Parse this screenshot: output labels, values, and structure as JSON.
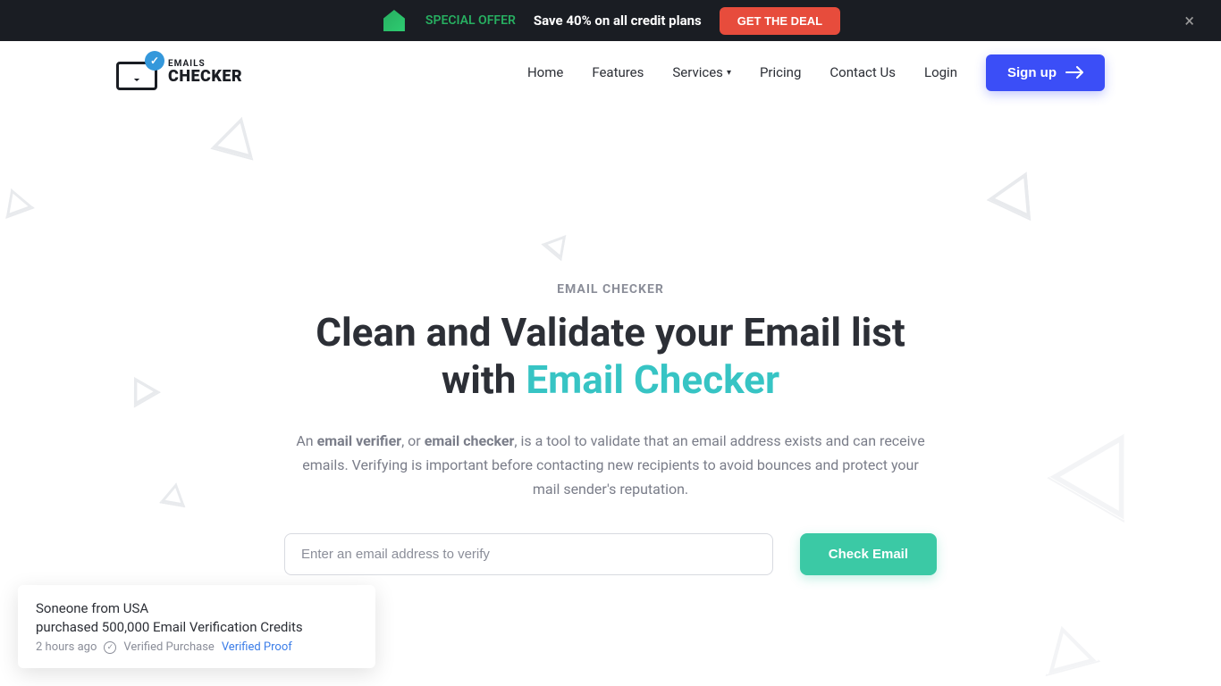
{
  "banner": {
    "special_offer": "SPECIAL OFFER",
    "save_text": "Save 40% on all credit plans",
    "deal_button": "GET THE DEAL",
    "close": "×"
  },
  "logo": {
    "top": "EMAILS",
    "bottom": "CHECKER",
    "check": "✓"
  },
  "nav": {
    "home": "Home",
    "features": "Features",
    "services": "Services",
    "pricing": "Pricing",
    "contact": "Contact Us",
    "login": "Login",
    "signup": "Sign up"
  },
  "hero": {
    "label": "EMAIL CHECKER",
    "title_line1": "Clean and Validate your Email list",
    "title_line2_prefix": "with ",
    "title_line2_accent": "Email Checker",
    "desc_prefix": "An ",
    "desc_bold1": "email verifier",
    "desc_mid1": ", or ",
    "desc_bold2": "email checker",
    "desc_suffix": ", is a tool to validate that an email address exists and can receive emails. Verifying is important before contacting new recipients to avoid bounces and protect your mail sender's reputation.",
    "input_placeholder": "Enter an email address to verify",
    "check_button": "Check Email"
  },
  "notification": {
    "line1": "Soneone from USA",
    "line2": "purchased 500,000 Email Verification Credits",
    "time": "2 hours ago",
    "verified_check": "✓",
    "verified_text": "Verified Purchase",
    "proof": "Verified Proof"
  }
}
